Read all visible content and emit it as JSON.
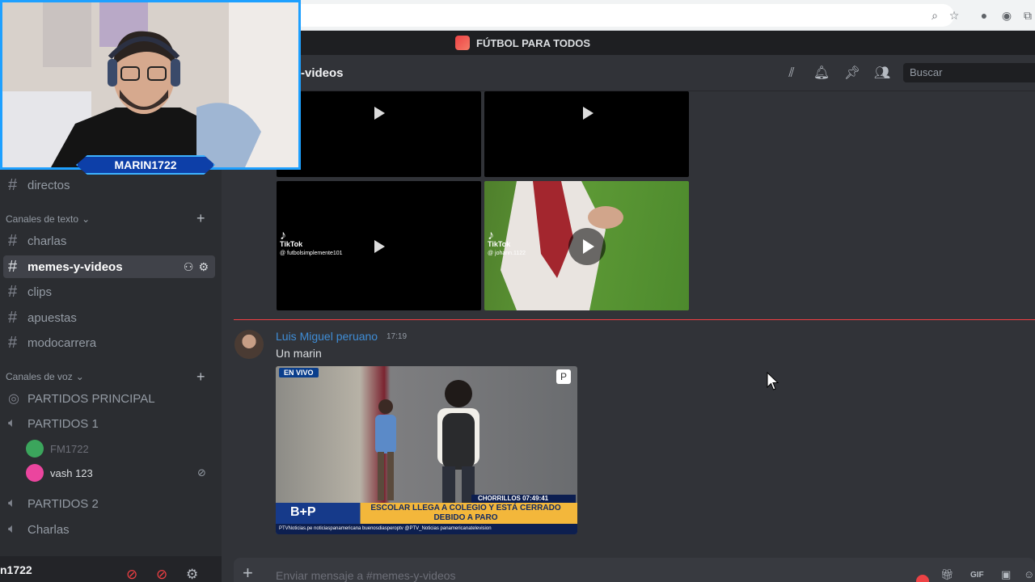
{
  "server": {
    "name": "FÚTBOL PARA TODOS"
  },
  "channel_header": {
    "name": "-videos",
    "search_placeholder": "Buscar"
  },
  "sidebar": {
    "top_channel": "directos",
    "text_category": "Canales de texto",
    "text_channels": [
      "charlas",
      "memes-y-videos",
      "clips",
      "apuestas",
      "modocarrera"
    ],
    "voice_category": "Canales de voz",
    "voice_channels": [
      "PARTIDOS PRINCIPAL",
      "PARTIDOS 1",
      "PARTIDOS 2",
      "Charlas"
    ],
    "voice_users": [
      {
        "name": "FM1722",
        "color": "#3ba55c"
      },
      {
        "name": "vash 123",
        "color": "#eb459e"
      }
    ],
    "user_name": "n1722"
  },
  "media": {
    "tiktok_label": "TikTok",
    "tiktok_handle_1": "@ futbolsimplemente101",
    "tiktok_handle_2": "@ johann.1122"
  },
  "message": {
    "author": "Luis Miguel peruano",
    "time": "17:19",
    "text": "Un marin",
    "embed": {
      "live": "EN VIVO",
      "location": "CHORRILLOS   07:49:41",
      "brand": "B+P",
      "headline": "ESCOLAR LLEGA A COLEGIO Y ESTÁ CERRADO DEBIDO A PARO",
      "footer": "PTVNoticias.pe   noticiaspanamericana   buenosdiasperoptv   @PTV_Noticias   panamericanatelevision"
    }
  },
  "composer": {
    "placeholder": "Enviar mensaje a #memes-y-videos"
  },
  "webcam": {
    "label": "MARIN1722"
  },
  "colors": {
    "accent": "#5865f2",
    "unread": "#f23f43",
    "author": "#3f8dd6",
    "cam_border": "#1ea0ff"
  }
}
